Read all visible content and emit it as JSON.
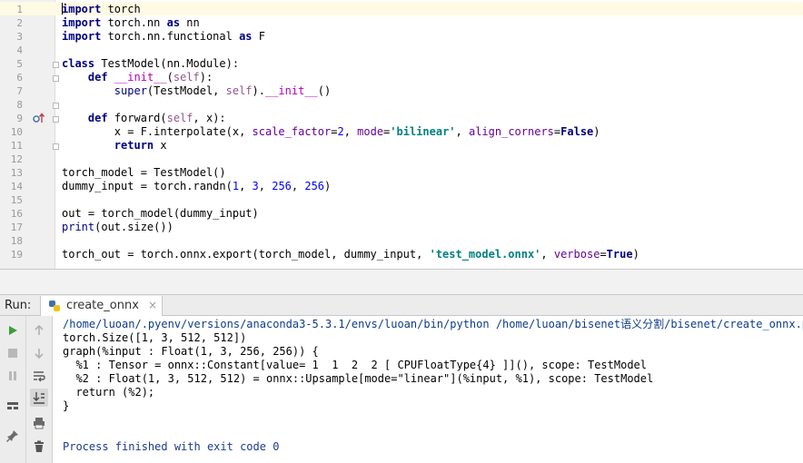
{
  "editor": {
    "lines": [
      {
        "n": "1",
        "tokens": [
          {
            "t": "import",
            "c": "kw"
          },
          {
            "t": " torch",
            "c": ""
          }
        ]
      },
      {
        "n": "2",
        "tokens": [
          {
            "t": "import",
            "c": "kw"
          },
          {
            "t": " torch.nn ",
            "c": ""
          },
          {
            "t": "as",
            "c": "kw"
          },
          {
            "t": " nn",
            "c": ""
          }
        ]
      },
      {
        "n": "3",
        "tokens": [
          {
            "t": "import",
            "c": "kw"
          },
          {
            "t": " torch.nn.functional ",
            "c": ""
          },
          {
            "t": "as",
            "c": "kw"
          },
          {
            "t": " F",
            "c": ""
          }
        ]
      },
      {
        "n": "4",
        "tokens": []
      },
      {
        "n": "5",
        "tokens": [
          {
            "t": "class",
            "c": "kw"
          },
          {
            "t": " TestModel(nn.Module):",
            "c": ""
          }
        ]
      },
      {
        "n": "6",
        "tokens": [
          {
            "t": "    ",
            "c": ""
          },
          {
            "t": "def",
            "c": "kw"
          },
          {
            "t": " ",
            "c": ""
          },
          {
            "t": "__init__",
            "c": "magic"
          },
          {
            "t": "(",
            "c": ""
          },
          {
            "t": "self",
            "c": "self"
          },
          {
            "t": "):",
            "c": ""
          }
        ]
      },
      {
        "n": "7",
        "tokens": [
          {
            "t": "        ",
            "c": ""
          },
          {
            "t": "super",
            "c": "builtin"
          },
          {
            "t": "(TestModel, ",
            "c": ""
          },
          {
            "t": "self",
            "c": "self"
          },
          {
            "t": ").",
            "c": ""
          },
          {
            "t": "__init__",
            "c": "magic"
          },
          {
            "t": "()",
            "c": ""
          }
        ]
      },
      {
        "n": "8",
        "tokens": []
      },
      {
        "n": "9",
        "tokens": [
          {
            "t": "    ",
            "c": ""
          },
          {
            "t": "def",
            "c": "kw"
          },
          {
            "t": " forward(",
            "c": ""
          },
          {
            "t": "self",
            "c": "self"
          },
          {
            "t": ", x):",
            "c": ""
          }
        ]
      },
      {
        "n": "10",
        "tokens": [
          {
            "t": "        x = F.interpolate(x, ",
            "c": ""
          },
          {
            "t": "scale_factor",
            "c": "param"
          },
          {
            "t": "=",
            "c": ""
          },
          {
            "t": "2",
            "c": "num"
          },
          {
            "t": ", ",
            "c": ""
          },
          {
            "t": "mode",
            "c": "param"
          },
          {
            "t": "=",
            "c": ""
          },
          {
            "t": "'bilinear'",
            "c": "str"
          },
          {
            "t": ", ",
            "c": ""
          },
          {
            "t": "align_corners",
            "c": "param"
          },
          {
            "t": "=",
            "c": ""
          },
          {
            "t": "False",
            "c": "kw"
          },
          {
            "t": ")",
            "c": ""
          }
        ]
      },
      {
        "n": "11",
        "tokens": [
          {
            "t": "        ",
            "c": ""
          },
          {
            "t": "return",
            "c": "kw"
          },
          {
            "t": " x",
            "c": ""
          }
        ]
      },
      {
        "n": "12",
        "tokens": []
      },
      {
        "n": "13",
        "tokens": [
          {
            "t": "torch_model = TestModel()",
            "c": ""
          }
        ]
      },
      {
        "n": "14",
        "tokens": [
          {
            "t": "dummy_input = torch.randn(",
            "c": ""
          },
          {
            "t": "1",
            "c": "num"
          },
          {
            "t": ", ",
            "c": ""
          },
          {
            "t": "3",
            "c": "num"
          },
          {
            "t": ", ",
            "c": ""
          },
          {
            "t": "256",
            "c": "num"
          },
          {
            "t": ", ",
            "c": ""
          },
          {
            "t": "256",
            "c": "num"
          },
          {
            "t": ")",
            "c": ""
          }
        ]
      },
      {
        "n": "15",
        "tokens": []
      },
      {
        "n": "16",
        "tokens": [
          {
            "t": "out = torch_model(dummy_input)",
            "c": ""
          }
        ]
      },
      {
        "n": "17",
        "tokens": [
          {
            "t": "print",
            "c": "builtin"
          },
          {
            "t": "(out.size())",
            "c": ""
          }
        ]
      },
      {
        "n": "18",
        "tokens": []
      },
      {
        "n": "19",
        "tokens": [
          {
            "t": "torch_out = torch.onnx.export(torch_model, dummy_input, ",
            "c": ""
          },
          {
            "t": "'test_model.onnx'",
            "c": "str"
          },
          {
            "t": ", ",
            "c": ""
          },
          {
            "t": "verbose",
            "c": "param"
          },
          {
            "t": "=",
            "c": ""
          },
          {
            "t": "True",
            "c": "kw"
          },
          {
            "t": ")",
            "c": ""
          }
        ]
      }
    ]
  },
  "run_panel": {
    "label": "Run:",
    "tab_label": "create_onnx",
    "tab_close": "×",
    "output": [
      {
        "text": "/home/luoan/.pyenv/versions/anaconda3-5.3.1/envs/luoan/bin/python /home/luoan/bisenet语义分割/bisenet/create_onnx.py",
        "cls": "link"
      },
      {
        "text": "torch.Size([1, 3, 512, 512])",
        "cls": ""
      },
      {
        "text": "graph(%input : Float(1, 3, 256, 256)) {",
        "cls": ""
      },
      {
        "text": "  %1 : Tensor = onnx::Constant[value= 1  1  2  2 [ CPUFloatType{4} ]](), scope: TestModel",
        "cls": ""
      },
      {
        "text": "  %2 : Float(1, 3, 512, 512) = onnx::Upsample[mode=\"linear\"](%input, %1), scope: TestModel",
        "cls": ""
      },
      {
        "text": "  return (%2);",
        "cls": ""
      },
      {
        "text": "}",
        "cls": ""
      },
      {
        "text": "",
        "cls": ""
      },
      {
        "text": "",
        "cls": ""
      },
      {
        "text": "Process finished with exit code 0",
        "cls": "exit"
      }
    ]
  },
  "colors": {
    "keyword": "#000080",
    "string": "#008080",
    "number": "#0000ff",
    "self": "#94558d",
    "param": "#660099",
    "run_green": "#3a9f3a"
  },
  "icons": {
    "gutter": "override-marker-icon",
    "tab": "python-file-icon",
    "toolbar": [
      "run-icon",
      "stop-icon",
      "pause-icon",
      "layout-icon",
      "pin-icon",
      "up-arrow-icon",
      "down-arrow-icon",
      "soft-wrap-icon",
      "scroll-to-end-icon",
      "print-icon",
      "trash-icon"
    ]
  }
}
